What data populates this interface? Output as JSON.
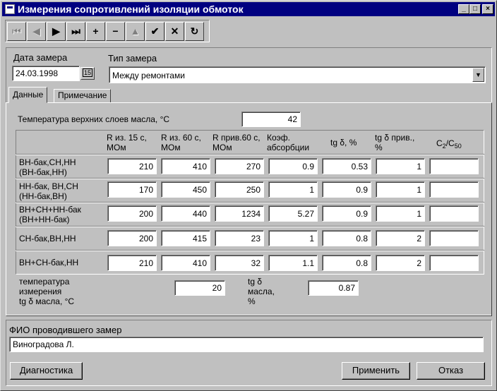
{
  "window": {
    "title": "Измерения сопротивлений изоляции обмоток",
    "controls": [
      "_",
      "□",
      "×"
    ]
  },
  "toolbar": {
    "buttons": [
      {
        "glyph": "⏮",
        "icon": "first-record-icon",
        "enabled": false
      },
      {
        "glyph": "◀",
        "icon": "prior-record-icon",
        "enabled": false
      },
      {
        "glyph": "▶",
        "icon": "next-record-icon",
        "enabled": true
      },
      {
        "glyph": "⏭",
        "icon": "last-record-icon",
        "enabled": true
      },
      {
        "glyph": "+",
        "icon": "insert-record-icon",
        "enabled": true
      },
      {
        "glyph": "−",
        "icon": "delete-record-icon",
        "enabled": true
      },
      {
        "glyph": "▲",
        "icon": "edit-record-icon",
        "enabled": false
      },
      {
        "glyph": "✔",
        "icon": "post-record-icon",
        "enabled": true
      },
      {
        "glyph": "✕",
        "icon": "cancel-edit-icon",
        "enabled": true
      },
      {
        "glyph": "↻",
        "icon": "refresh-icon",
        "enabled": true
      }
    ]
  },
  "header": {
    "date_label": "Дата замера",
    "date_value": "24.03.1998",
    "date_button": "15",
    "type_label": "Тип замера",
    "type_value": "Между ремонтами"
  },
  "tabs": [
    {
      "label": "Данные",
      "active": true
    },
    {
      "label": "Примечание",
      "active": false
    }
  ],
  "data_tab": {
    "oil_temp_label": "Температура верхних слоев масла,  °C",
    "oil_temp_value": "42",
    "columns": [
      {
        "line1": "R из. 15 с,",
        "line2": "МОм"
      },
      {
        "line1": "R из. 60 с,",
        "line2": "МОм"
      },
      {
        "line1": "R прив.60 с,",
        "line2": "МОм"
      },
      {
        "line1": "Коэф.",
        "line2": "абсорбции"
      },
      {
        "line1": "tg δ, %",
        "line2": ""
      },
      {
        "line1": "tg δ прив.,",
        "line2": "%"
      },
      {
        "line1": "C",
        "sub1": "2",
        "mid": "/C",
        "sub2": "50"
      }
    ],
    "rows": [
      {
        "line1": "ВН-бак,СН,НН",
        "line2": "(ВН-бак,НН)",
        "values": [
          "210",
          "410",
          "270",
          "0.9",
          "0.53",
          "1",
          ""
        ]
      },
      {
        "line1": " НН-бак, ВН,СН",
        "line2": " (НН-бак,ВН)",
        "values": [
          "170",
          "450",
          "250",
          "1",
          "0.9",
          "1",
          ""
        ]
      },
      {
        "line1": "ВН+СН+НН-бак",
        "line2": "(ВН+НН-бак)",
        "values": [
          "200",
          "440",
          "1234",
          "5.27",
          "0.9",
          "1",
          ""
        ]
      },
      {
        "line1": "СН-бак,ВН,НН",
        "line2": "",
        "values": [
          "200",
          "415",
          "23",
          "1",
          "0.8",
          "2",
          ""
        ]
      },
      {
        "line1": "ВН+СН-бак,НН",
        "line2": "",
        "values": [
          "210",
          "410",
          "32",
          "1.1",
          "0.8",
          "2",
          ""
        ]
      }
    ],
    "tg_temp_label": [
      "температура",
      "измерения",
      "tg δ масла,  °C"
    ],
    "tg_temp_value": "20",
    "tg_oil_label": [
      "tg δ",
      "масла,",
      "%"
    ],
    "tg_oil_value": "0.87"
  },
  "footer": {
    "person_label": "ФИО проводившего замер",
    "person_value": "Виноградова Л.",
    "diagnostics_label": "Диагностика",
    "apply_label": "Применить",
    "cancel_label": "Отказ"
  }
}
